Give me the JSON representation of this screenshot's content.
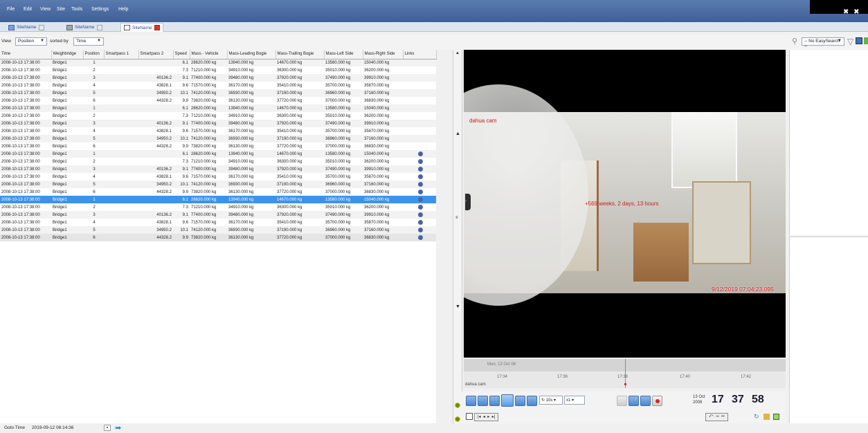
{
  "menu": [
    "File",
    "Edit",
    "View",
    "Site",
    "Tools",
    "Settings",
    "Help"
  ],
  "window_controls": "✖ ✖",
  "tabs": [
    {
      "label": "SiteName",
      "icon": "site-icon"
    },
    {
      "label": "SiteName",
      "icon": "network-icon"
    },
    {
      "label": "SiteName",
      "icon": "table-icon"
    }
  ],
  "toolbar": {
    "view_label": "View",
    "view_value": "Position",
    "sorted_label": "sorted by",
    "sorted_value": "Time",
    "easysearch_value": "-- No EasySearch --"
  },
  "table": {
    "columns": [
      "Time",
      "Weighbridge",
      "Position",
      "Smartpass 1",
      "Smartpass 2",
      "Speed",
      "Mass - Vehicle",
      "Mass-Leading Bogie",
      "Mass-Trailing Bogie",
      "Mass-Left Side",
      "Mass-Right Side",
      "Links"
    ],
    "rows": [
      [
        "2008-10-13 17:38:00",
        "Bridge1",
        "1",
        "",
        "",
        "6.1",
        "28620.000 kg",
        "13940.000 kg",
        "14670.000 kg",
        "13580.000 kg",
        "15040.000 kg",
        ""
      ],
      [
        "2008-10-13 17:38:00",
        "Bridge1",
        "2",
        "",
        "",
        "7.3",
        "71210.000 kg",
        "34910.000 kg",
        "36300.000 kg",
        "35010.000 kg",
        "36200.000 kg",
        ""
      ],
      [
        "2008-10-13 17:38:00",
        "Bridge1",
        "3",
        "",
        "40136.2",
        "9.1",
        "77400.000 kg",
        "39480.000 kg",
        "37920.000 kg",
        "37490.000 kg",
        "39910.000 kg",
        ""
      ],
      [
        "2008-10-13 17:38:00",
        "Bridge1",
        "4",
        "",
        "43828.1",
        "9.6",
        "71570.000 kg",
        "36170.000 kg",
        "35410.000 kg",
        "35700.000 kg",
        "35870.000 kg",
        ""
      ],
      [
        "2008-10-13 17:38:00",
        "Bridge1",
        "5",
        "",
        "34950.2",
        "10.1",
        "74120.000 kg",
        "36930.000 kg",
        "37190.000 kg",
        "36960.000 kg",
        "37160.000 kg",
        ""
      ],
      [
        "2008-10-13 17:38:00",
        "Bridge1",
        "6",
        "",
        "44328.2",
        "9.9",
        "73820.000 kg",
        "36130.000 kg",
        "37720.000 kg",
        "37000.000 kg",
        "36830.000 kg",
        ""
      ],
      [
        "2008-10-13 17:38:00",
        "Bridge1",
        "1",
        "",
        "",
        "6.1",
        "28620.000 kg",
        "13940.000 kg",
        "14670.000 kg",
        "13580.000 kg",
        "15040.000 kg",
        ""
      ],
      [
        "2008-10-13 17:38:00",
        "Bridge1",
        "2",
        "",
        "",
        "7.3",
        "71210.000 kg",
        "34910.000 kg",
        "36300.000 kg",
        "35010.000 kg",
        "36200.000 kg",
        ""
      ],
      [
        "2008-10-13 17:38:00",
        "Bridge1",
        "3",
        "",
        "40136.2",
        "9.1",
        "77400.000 kg",
        "39480.000 kg",
        "37920.000 kg",
        "37490.000 kg",
        "39910.000 kg",
        ""
      ],
      [
        "2008-10-13 17:38:00",
        "Bridge1",
        "4",
        "",
        "43828.1",
        "9.6",
        "71570.000 kg",
        "36170.000 kg",
        "35410.000 kg",
        "35700.000 kg",
        "35870.000 kg",
        ""
      ],
      [
        "2008-10-13 17:38:00",
        "Bridge1",
        "5",
        "",
        "34950.2",
        "10.1",
        "74120.000 kg",
        "36930.000 kg",
        "37190.000 kg",
        "36960.000 kg",
        "37160.000 kg",
        ""
      ],
      [
        "2008-10-13 17:38:00",
        "Bridge1",
        "6",
        "",
        "44328.2",
        "9.9",
        "73820.000 kg",
        "36130.000 kg",
        "37720.000 kg",
        "37000.000 kg",
        "36830.000 kg",
        ""
      ],
      [
        "2008-10-13 17:38:00",
        "Bridge1",
        "1",
        "",
        "",
        "6.1",
        "28620.000 kg",
        "13940.000 kg",
        "14670.000 kg",
        "13580.000 kg",
        "15040.000 kg",
        "link"
      ],
      [
        "2008-10-13 17:38:00",
        "Bridge1",
        "2",
        "",
        "",
        "7.3",
        "71210.000 kg",
        "34910.000 kg",
        "36300.000 kg",
        "35010.000 kg",
        "36200.000 kg",
        "link"
      ],
      [
        "2008-10-13 17:38:00",
        "Bridge1",
        "3",
        "",
        "40136.2",
        "9.1",
        "77400.000 kg",
        "39480.000 kg",
        "37920.000 kg",
        "37490.000 kg",
        "39910.000 kg",
        "link"
      ],
      [
        "2008-10-13 17:38:00",
        "Bridge1",
        "4",
        "",
        "43828.1",
        "9.6",
        "71570.000 kg",
        "36170.000 kg",
        "35410.000 kg",
        "35700.000 kg",
        "35870.000 kg",
        "link"
      ],
      [
        "2008-10-13 17:38:00",
        "Bridge1",
        "5",
        "",
        "34950.2",
        "10.1",
        "74120.000 kg",
        "36930.000 kg",
        "37190.000 kg",
        "36960.000 kg",
        "37160.000 kg",
        "link"
      ],
      [
        "2008-10-13 17:38:00",
        "Bridge1",
        "6",
        "",
        "44328.2",
        "9.9",
        "73820.000 kg",
        "36130.000 kg",
        "37720.000 kg",
        "37000.000 kg",
        "36830.000 kg",
        "link"
      ],
      [
        "2008-10-13 17:38:00",
        "Bridge1",
        "1",
        "",
        "",
        "6.1",
        "28620.000 kg",
        "13940.000 kg",
        "14670.000 kg",
        "13580.000 kg",
        "15040.000 kg",
        "link"
      ],
      [
        "2008-10-13 17:38:00",
        "Bridge1",
        "2",
        "",
        "",
        "7.3",
        "71210.000 kg",
        "34910.000 kg",
        "36300.000 kg",
        "35010.000 kg",
        "36200.000 kg",
        "link"
      ],
      [
        "2008-10-13 17:38:00",
        "Bridge1",
        "3",
        "",
        "40136.2",
        "9.1",
        "77400.000 kg",
        "39480.000 kg",
        "37920.000 kg",
        "37490.000 kg",
        "39910.000 kg",
        "link"
      ],
      [
        "2008-10-13 17:38:00",
        "Bridge1",
        "4",
        "",
        "43828.1",
        "9.6",
        "71570.000 kg",
        "36170.000 kg",
        "35410.000 kg",
        "35700.000 kg",
        "35870.000 kg",
        "link"
      ],
      [
        "2008-10-13 17:38:00",
        "Bridge1",
        "5",
        "",
        "34950.2",
        "10.1",
        "74120.000 kg",
        "36930.000 kg",
        "37190.000 kg",
        "36960.000 kg",
        "37160.000 kg",
        "link"
      ],
      [
        "2008-10-13 17:38:00",
        "Bridge1",
        "6",
        "",
        "44328.2",
        "9.9",
        "73820.000 kg",
        "36130.000 kg",
        "37720.000 kg",
        "37000.000 kg",
        "36830.000 kg",
        "link"
      ]
    ],
    "selected_row": 18
  },
  "video": {
    "camera_name": "dahua cam",
    "overlay_age": "+569 weeks, 2 days, 13 hours",
    "timestamp": "9/12/2019 07:04:23.095"
  },
  "timeline": {
    "date_label": "Mon, 13 Oct 08",
    "ticks": [
      "17:34",
      "17:36",
      "17:38",
      "17:40",
      "17:42"
    ],
    "track_label": "dahua cam"
  },
  "playback": {
    "step_value": "10s",
    "speed_value": "x1",
    "clock_day": "13 Oct",
    "clock_year": "2008",
    "clock_h": "17",
    "clock_m": "37",
    "clock_s": "58"
  },
  "statusbar": {
    "goto_label": "Goto Time",
    "goto_value": "2019-09-12 08:14:36"
  },
  "colors": {
    "menubar": "#4a6aa3",
    "selected_row": "#3d93ea",
    "overlay_text": "#d21c1c"
  }
}
